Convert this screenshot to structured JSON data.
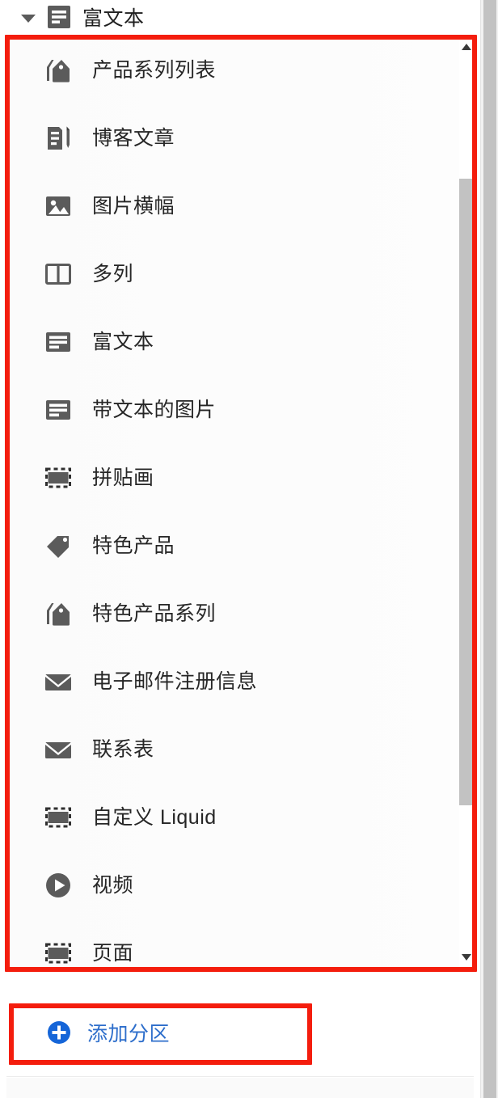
{
  "header": {
    "title": "富文本",
    "caret_icon": "chevron-down-icon",
    "section_icon": "rich-text-icon"
  },
  "section_list": {
    "items": [
      {
        "label": "产品系列列表",
        "icon": "collection-tag-icon"
      },
      {
        "label": "博客文章",
        "icon": "blog-post-icon"
      },
      {
        "label": "图片横幅",
        "icon": "image-banner-icon"
      },
      {
        "label": "多列",
        "icon": "multi-column-icon"
      },
      {
        "label": "富文本",
        "icon": "rich-text-icon"
      },
      {
        "label": "带文本的图片",
        "icon": "image-with-text-icon"
      },
      {
        "label": "拼贴画",
        "icon": "collage-icon"
      },
      {
        "label": "特色产品",
        "icon": "tag-icon"
      },
      {
        "label": "特色产品系列",
        "icon": "collection-tag-icon"
      },
      {
        "label": "电子邮件注册信息",
        "icon": "envelope-icon"
      },
      {
        "label": "联系表",
        "icon": "envelope-icon"
      },
      {
        "label": "自定义 Liquid",
        "icon": "custom-liquid-icon"
      },
      {
        "label": "视频",
        "icon": "play-circle-icon"
      },
      {
        "label": "页面",
        "icon": "page-icon"
      }
    ],
    "scrollbar": {
      "up_arrow_icon": "scroll-up-arrow-icon",
      "down_arrow_icon": "scroll-down-arrow-icon"
    }
  },
  "add_section": {
    "label": "添加分区",
    "icon": "plus-circle-icon"
  },
  "colors": {
    "icon_gray": "#5b5b5b",
    "text_dark": "#262626",
    "link_blue": "#2d6ecb",
    "annotation_red": "#f41d0d",
    "scrollbar_gray": "#c2c2c2",
    "panel_bg": "#fbfbfb"
  }
}
